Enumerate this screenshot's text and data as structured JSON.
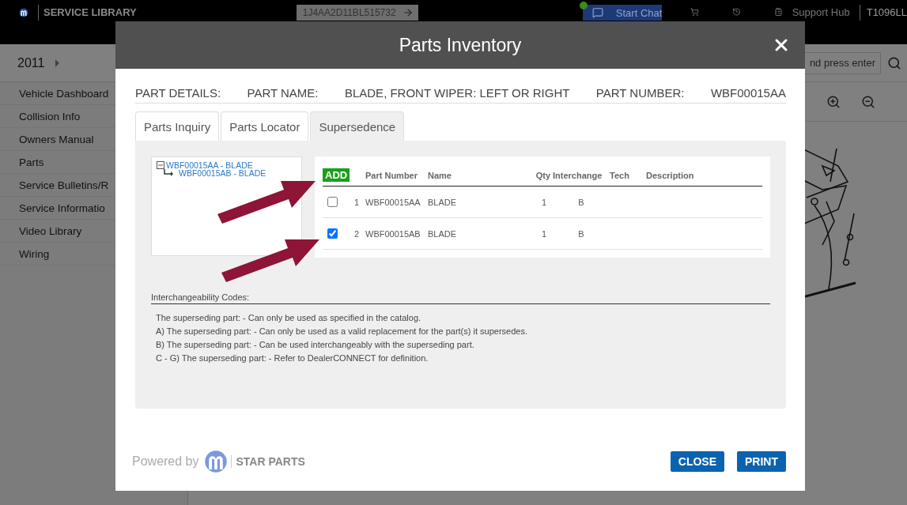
{
  "header": {
    "logo_text": "SERVICE LIBRARY",
    "vin": "1J4AA2D11BL515732",
    "chat_button": "Start Chat",
    "chat_online": true,
    "support_hub": "Support Hub",
    "user": "T1096LL"
  },
  "toolbar": {
    "year": "2011",
    "search_placeholder": "nd press enter"
  },
  "sidebar": {
    "items": [
      {
        "label": "Vehicle Dashboard"
      },
      {
        "label": "Collision Info"
      },
      {
        "label": "Owners Manual"
      },
      {
        "label": "Parts"
      },
      {
        "label": "Service Bulletins/R"
      },
      {
        "label": "Service Informatio"
      },
      {
        "label": "Video Library"
      },
      {
        "label": "Wiring"
      }
    ]
  },
  "modal": {
    "title": "Parts Inventory",
    "details": {
      "section_label": "PART DETAILS:",
      "name_label": "PART NAME:",
      "name": "BLADE, FRONT WIPER: LEFT OR RIGHT",
      "number_label": "PART NUMBER:",
      "number": "WBF00015AA"
    },
    "tabs": [
      {
        "label": "Parts Inquiry",
        "selected": false
      },
      {
        "label": "Parts Locator",
        "selected": false
      },
      {
        "label": "Supersedence",
        "selected": true
      }
    ],
    "tree": {
      "label": "WBF00015AA - BLADE",
      "expanded": true,
      "children": [
        {
          "label": "WBF00015AB - BLADE"
        }
      ]
    },
    "table": {
      "add_button": "ADD",
      "columns": [
        "Part Number",
        "Name",
        "Qty",
        "Interchange",
        "Tech",
        "Description"
      ],
      "rows": [
        {
          "index": "1",
          "part_number": "WBF00015AA",
          "name": "BLADE",
          "qty": "1",
          "interchange": "B",
          "checked": false
        },
        {
          "index": "2",
          "part_number": "WBF00015AB",
          "name": "BLADE",
          "qty": "1",
          "interchange": "B",
          "checked": true
        }
      ]
    },
    "codes": {
      "title": "Interchangeability Codes:",
      "lines": [
        "The superseding part: - Can only be used as specified in the catalog.",
        "A) The superseding part: - Can only be used as a valid replacement for the part(s) it supersedes.",
        "B) The superseding part: - Can be used interchangeably with the superseding part.",
        "C - G) The superseding part: - Refer to DealerCONNECT for definition."
      ]
    },
    "footer": {
      "powered_by": "Powered by",
      "brand": "STAR PARTS",
      "buttons": [
        "CLOSE",
        "PRINT"
      ]
    }
  }
}
